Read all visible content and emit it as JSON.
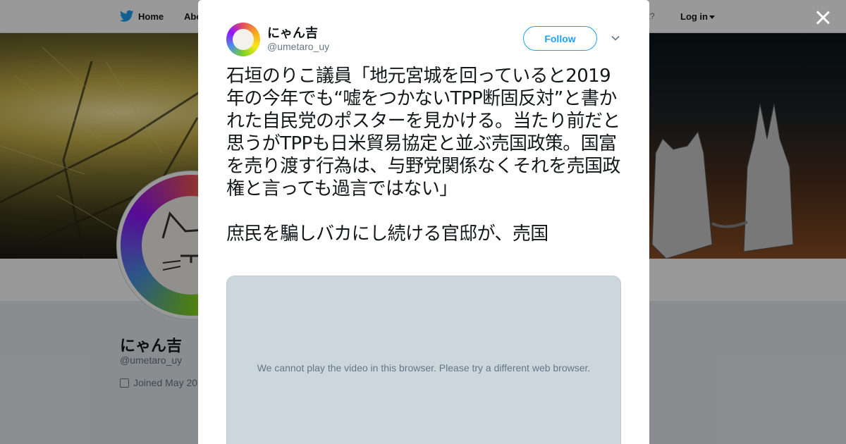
{
  "topnav": {
    "home_label": "Home",
    "about_label": "Abo",
    "account_prompt": "account?",
    "login_label": "Log in"
  },
  "profile": {
    "name": "にゃん吉",
    "handle": "@umetaro_uy",
    "joined": "Joined May 20"
  },
  "tweet": {
    "author_name": "にゃん吉",
    "author_handle": "@umetaro_uy",
    "follow_label": "Follow",
    "text": "石垣のりこ議員「地元宮城を回っていると2019年の今年でも“嘘をつかないTPP断固反対”と書かれた自民党のポスターを見かける。当たり前だと思うがTPPも日米貿易協定と並ぶ売国政策。国富を売り渡す行為は、与野党関係なくそれを売国政権と言っても過言ではない」\n\n庶民を騙しバカにし続ける官邸が、売国",
    "video_message": "We cannot play the video in this browser. Please try a different web browser."
  },
  "icons": {
    "twitter": "twitter-bird-icon",
    "close": "close-icon",
    "chevron": "chevron-down-icon",
    "calendar": "calendar-icon"
  },
  "colors": {
    "accent": "#1da1f2",
    "text": "#14171a",
    "secondary_text": "#657786",
    "video_bg": "#ccd6dd"
  }
}
